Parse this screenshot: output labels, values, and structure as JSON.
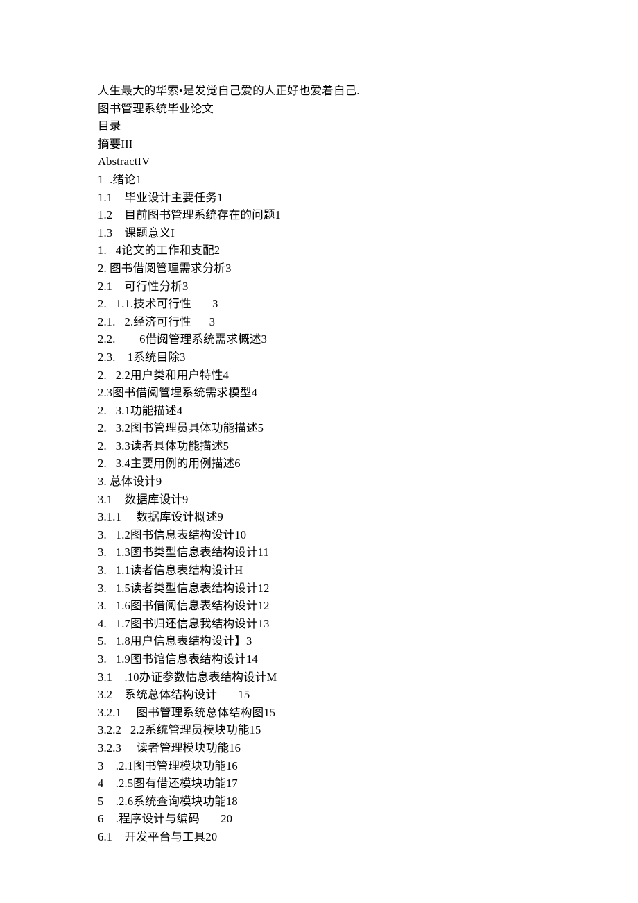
{
  "lines": [
    "人生最大的华索•是发觉自己爱的人正好也爱着自己.",
    "图书管理系统毕业论文",
    "目录",
    "摘要III",
    "AbstractIV",
    "1  .绪论1",
    "1.1    毕业设计主要任务1",
    "1.2    目前图书管理系统存在的问题1",
    "1.3    课题意义I",
    "1.   4论文的工作和支配2",
    "2. 图书借阅管理需求分析3",
    "2.1    可行性分析3",
    "2.   1.1.技术可行性       3",
    "2.1.   2.经济可行性      3",
    "2.2.        6借阅管理系统需求概述3",
    "2.3.    1系统目除3",
    "2.   2.2用户类和用户特性4",
    "2.3图书借阅管埋系统需求模型4",
    "2.   3.1功能描述4",
    "2.   3.2图书管理员具体功能描述5",
    "2.   3.3读者具体功能描述5",
    "2.   3.4主要用例的用例描述6",
    "3. 总体设计9",
    "3.1    数据库设计9",
    "3.1.1     数据库设计概述9",
    "3.   1.2图书信息表结构设计10",
    "3.   1.3图书类型信息表结构设计11",
    "3.   1.1读者信息表结构设计H",
    "3.   1.5读者类型信息表结构设计12",
    "3.   1.6图书借阅信息表结构设计12",
    "4.   1.7图书归还信息我结构设计13",
    "5.   1.8用户信息表结构设计】3",
    "3.   1.9图书馆信息表结构设计14",
    "3.1    .10办证参数怙息表结构设计M",
    "3.2    系统总体结构设计       15",
    "3.2.1     图书管理系统总体结构图15",
    "3.2.2   2.2系统管理员模块功能15",
    "3.2.3     读者管理模块功能16",
    "3    .2.1图书管理模块功能16",
    "4    .2.5图有借还模块功能17",
    "5    .2.6系统查询模块功能18",
    "6    .程序设计与编码       20",
    "6.1    开发平台与工具20"
  ]
}
